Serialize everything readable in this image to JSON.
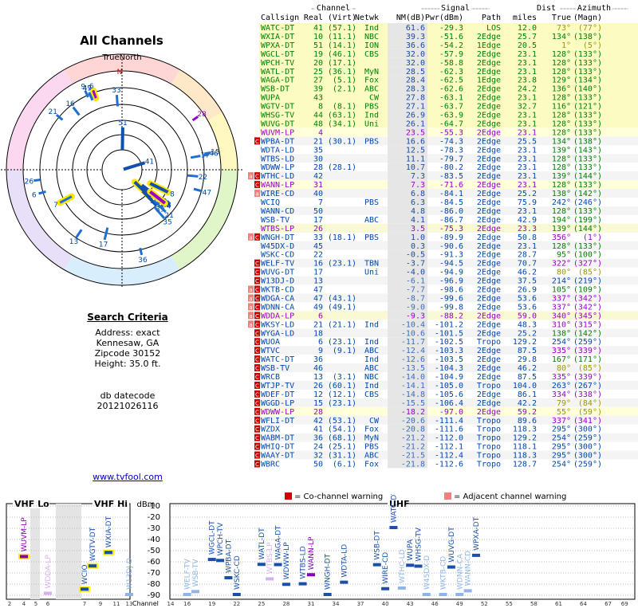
{
  "page": {
    "title": "All Channels",
    "north_label": "TrueNorth",
    "criteria": {
      "heading": "Search Criteria",
      "lines": [
        "Address: exact",
        "Kennesaw, GA",
        "Zipcode 30152",
        "Height: 35.0 ft."
      ],
      "datecode_label": "db datecode",
      "datecode": "20121026116"
    },
    "link": "www.tvfool.com",
    "warnings": {
      "co": "= Co-channel warning",
      "adj": "= Adjacent channel warning"
    }
  },
  "colors": {
    "green": "#008000",
    "blue": "#0047ab",
    "lightblue": "#6a9bd8",
    "violet": "#9900cc",
    "gray": "#808080",
    "olive": "#999900",
    "red": "#cc0000"
  },
  "table": {
    "group_headers": {
      "channel": "Channel",
      "signal": "Signal",
      "dist": "Dist",
      "azimuth": "Azimuth"
    },
    "columns": [
      "Callsign",
      "Real",
      "(Virt)",
      "Netwk",
      "NM(dB)",
      "Pwr(dBm)",
      "Path",
      "miles",
      "True",
      "(Magn)"
    ],
    "rows": [
      [
        "WATC-DT",
        "41",
        "(57.1)",
        "Ind",
        "61.6",
        "-29.3",
        "LOS",
        "12.0",
        "73°",
        "(77°)",
        "",
        "green"
      ],
      [
        "WXIA-DT",
        "10",
        "(11.1)",
        "NBC",
        "39.3",
        "-51.6",
        "2Edge",
        "25.7",
        "134°",
        "(138°)",
        "",
        "green"
      ],
      [
        "WPXA-DT",
        "51",
        "(14.1)",
        "ION",
        "36.6",
        "-54.2",
        "1Edge",
        "20.5",
        "1°",
        "(5°)",
        "",
        "green"
      ],
      [
        "WGCL-DT",
        "19",
        "(46.1)",
        "CBS",
        "32.0",
        "-57.9",
        "2Edge",
        "23.1",
        "128°",
        "(133°)",
        "",
        "green"
      ],
      [
        "WPCH-TV",
        "20",
        "(17.1)",
        "",
        "32.0",
        "-58.8",
        "2Edge",
        "23.1",
        "128°",
        "(133°)",
        "",
        "green"
      ],
      [
        "WATL-DT",
        "25",
        "(36.1)",
        "MyN",
        "28.5",
        "-62.3",
        "2Edge",
        "23.1",
        "128°",
        "(133°)",
        "",
        "green"
      ],
      [
        "WAGA-DT",
        "27",
        "(5.1)",
        "Fox",
        "28.4",
        "-62.5",
        "1Edge",
        "23.8",
        "129°",
        "(134°)",
        "",
        "green"
      ],
      [
        "WSB-DT",
        "39",
        "(2.1)",
        "ABC",
        "28.3",
        "-62.6",
        "2Edge",
        "24.2",
        "136°",
        "(140°)",
        "",
        "green"
      ],
      [
        "WUPA",
        "43",
        "",
        "CW",
        "27.8",
        "-63.1",
        "2Edge",
        "23.1",
        "128°",
        "(133°)",
        "",
        "green"
      ],
      [
        "WGTV-DT",
        "8",
        "(8.1)",
        "PBS",
        "27.1",
        "-63.7",
        "2Edge",
        "32.7",
        "116°",
        "(121°)",
        "",
        "green"
      ],
      [
        "WHSG-TV",
        "44",
        "(63.1)",
        "Ind",
        "26.9",
        "-63.9",
        "2Edge",
        "23.1",
        "128°",
        "(133°)",
        "",
        "green"
      ],
      [
        "WUVG-DT",
        "48",
        "(34.1)",
        "Uni",
        "26.1",
        "-64.7",
        "2Edge",
        "23.1",
        "128°",
        "(133°)",
        "",
        "green"
      ],
      [
        "WUVM-LP",
        "4",
        "",
        "",
        "23.5",
        "-55.3",
        "2Edge",
        "23.1",
        "128°",
        "(133°)",
        "",
        "violet"
      ],
      [
        "WPBA-DT",
        "21",
        "(30.1)",
        "PBS",
        "16.6",
        "-74.3",
        "2Edge",
        "25.5",
        "134°",
        "(138°)",
        "C",
        "blue"
      ],
      [
        "WDTA-LD",
        "35",
        "",
        "",
        "12.5",
        "-78.3",
        "2Edge",
        "23.1",
        "139°",
        "(143°)",
        "",
        "blue"
      ],
      [
        "WTBS-LD",
        "30",
        "",
        "",
        "11.1",
        "-79.7",
        "2Edge",
        "23.1",
        "128°",
        "(133°)",
        "",
        "blue"
      ],
      [
        "WDWW-LP",
        "28",
        "(28.1)",
        "",
        "10.7",
        "-80.2",
        "2Edge",
        "23.1",
        "128°",
        "(133°)",
        "",
        "blue"
      ],
      [
        "WTHC-LD",
        "42",
        "",
        "",
        "7.3",
        "-83.5",
        "2Edge",
        "23.1",
        "139°",
        "(144°)",
        "aC",
        "blue"
      ],
      [
        "WANN-LP",
        "31",
        "",
        "",
        "7.3",
        "-71.6",
        "2Edge",
        "23.1",
        "128°",
        "(133°)",
        "C",
        "violet"
      ],
      [
        "WIRE-CD",
        "40",
        "",
        "",
        "6.8",
        "-84.1",
        "2Edge",
        "25.2",
        "138°",
        "(142°)",
        "a",
        "blue"
      ],
      [
        "WCIQ",
        "7",
        "",
        "PBS",
        "6.3",
        "-84.5",
        "2Edge",
        "75.9",
        "242°",
        "(246°)",
        "",
        "blue"
      ],
      [
        "WANN-CD",
        "50",
        "",
        "",
        "4.8",
        "-86.0",
        "2Edge",
        "23.1",
        "128°",
        "(133°)",
        "",
        "blue"
      ],
      [
        "WSB-TV",
        "17",
        "",
        "ABC",
        "4.1",
        "-86.7",
        "2Edge",
        "42.9",
        "194°",
        "(199°)",
        "",
        "blue"
      ],
      [
        "WTBS-LP",
        "26",
        "",
        "",
        "3.5",
        "-75.3",
        "2Edge",
        "23.3",
        "139°",
        "(144°)",
        "",
        "violet"
      ],
      [
        "WNGH-DT",
        "33",
        "(18.1)",
        "PBS",
        "1.0",
        "-89.9",
        "2Edge",
        "50.8",
        "356°",
        "(1°)",
        "aC",
        "blue"
      ],
      [
        "W45DX-D",
        "45",
        "",
        "",
        "0.3",
        "-90.6",
        "2Edge",
        "23.1",
        "128°",
        "(133°)",
        "",
        "blue"
      ],
      [
        "WSKC-CD",
        "22",
        "",
        "",
        "-0.5",
        "-91.3",
        "2Edge",
        "28.7",
        "95°",
        "(100°)",
        "",
        "blue"
      ],
      [
        "WELF-TV",
        "16",
        "(23.1)",
        "TBN",
        "-3.7",
        "-94.5",
        "2Edge",
        "70.7",
        "322°",
        "(327°)",
        "C",
        "blue"
      ],
      [
        "WUVG-DT",
        "17",
        "",
        "Uni",
        "-4.0",
        "-94.9",
        "2Edge",
        "46.2",
        "80°",
        "(85°)",
        "C",
        "blue"
      ],
      [
        "W13DJ-D",
        "13",
        "",
        "",
        "-6.1",
        "-96.9",
        "2Edge",
        "37.5",
        "214°",
        "(219°)",
        "C",
        "blue"
      ],
      [
        "WKTB-CD",
        "47",
        "",
        "",
        "-7.7",
        "-98.6",
        "2Edge",
        "26.9",
        "105°",
        "(109°)",
        "aC",
        "blue"
      ],
      [
        "WDGA-CA",
        "47",
        "(43.1)",
        "",
        "-8.7",
        "-99.6",
        "2Edge",
        "53.6",
        "337°",
        "(342°)",
        "aC",
        "blue"
      ],
      [
        "WDNN-CA",
        "49",
        "(49.1)",
        "",
        "-9.0",
        "-99.8",
        "2Edge",
        "53.6",
        "337°",
        "(342°)",
        "aC",
        "blue"
      ],
      [
        "WDDA-LP",
        "6",
        "",
        "",
        "-9.3",
        "-88.2",
        "2Edge",
        "59.0",
        "340°",
        "(345°)",
        "aC",
        "violet"
      ],
      [
        "WKSY-LD",
        "21",
        "(21.1)",
        "Ind",
        "-10.4",
        "-101.2",
        "2Edge",
        "48.3",
        "310°",
        "(315°)",
        "aC",
        "blue"
      ],
      [
        "WYGA-LD",
        "18",
        "",
        "",
        "-10.6",
        "-101.5",
        "2Edge",
        "25.2",
        "138°",
        "(142°)",
        "C",
        "blue"
      ],
      [
        "WUOA",
        "6",
        "(23.1)",
        "Ind",
        "-11.7",
        "-102.5",
        "Tropo",
        "129.2",
        "254°",
        "(259°)",
        "C",
        "blue"
      ],
      [
        "WTVC",
        "9",
        "(9.1)",
        "ABC",
        "-12.4",
        "-103.3",
        "2Edge",
        "87.5",
        "335°",
        "(339°)",
        "C",
        "blue"
      ],
      [
        "WATC-DT",
        "36",
        "",
        "Ind",
        "-12.6",
        "-103.5",
        "2Edge",
        "29.8",
        "167°",
        "(171°)",
        "C",
        "blue"
      ],
      [
        "WSB-TV",
        "46",
        "",
        "ABC",
        "-13.5",
        "-104.3",
        "2Edge",
        "46.2",
        "80°",
        "(85°)",
        "C",
        "blue"
      ],
      [
        "WRCB",
        "13",
        "(3.1)",
        "NBC",
        "-14.0",
        "-104.9",
        "2Edge",
        "87.5",
        "335°",
        "(339°)",
        "C",
        "blue"
      ],
      [
        "WTJP-TV",
        "26",
        "(60.1)",
        "Ind",
        "-14.1",
        "-105.0",
        "Tropo",
        "104.0",
        "263°",
        "(267°)",
        "C",
        "blue"
      ],
      [
        "WDEF-DT",
        "12",
        "(12.1)",
        "CBS",
        "-14.8",
        "-105.6",
        "2Edge",
        "86.1",
        "334°",
        "(338°)",
        "C",
        "blue"
      ],
      [
        "WGGD-LP",
        "15",
        "(23.1)",
        "",
        "-15.5",
        "-106.4",
        "2Edge",
        "42.2",
        "79°",
        "(84°)",
        "C",
        "blue"
      ],
      [
        "WDWW-LP",
        "28",
        "",
        "",
        "-18.2",
        "-97.0",
        "2Edge",
        "59.2",
        "55°",
        "(59°)",
        "C",
        "violet"
      ],
      [
        "WFLI-DT",
        "42",
        "(53.1)",
        "CW",
        "-20.6",
        "-111.4",
        "Tropo",
        "89.6",
        "337°",
        "(341°)",
        "C",
        "blue"
      ],
      [
        "WZDX",
        "41",
        "(54.1)",
        "Fox",
        "-20.8",
        "-111.6",
        "Tropo",
        "118.3",
        "295°",
        "(300°)",
        "C",
        "blue"
      ],
      [
        "WABM-DT",
        "36",
        "(68.1)",
        "MyN",
        "-21.2",
        "-112.0",
        "Tropo",
        "129.2",
        "254°",
        "(259°)",
        "C",
        "blue"
      ],
      [
        "WHIQ-DT",
        "24",
        "(25.1)",
        "PBS",
        "-21.2",
        "-112.1",
        "Tropo",
        "118.1",
        "295°",
        "(300°)",
        "C",
        "blue"
      ],
      [
        "WAAY-DT",
        "32",
        "(31.1)",
        "ABC",
        "-21.5",
        "-112.4",
        "Tropo",
        "118.3",
        "295°",
        "(300°)",
        "C",
        "blue"
      ],
      [
        "WBRC",
        "50",
        "(6.1)",
        "Fox",
        "-21.8",
        "-112.6",
        "Tropo",
        "128.7",
        "254°",
        "(259°)",
        "C",
        "blue"
      ]
    ]
  },
  "chart_data": [
    {
      "type": "scatter",
      "title": "All Channels",
      "subtype": "polar",
      "axis": "azimuth in degrees (true north at top), radius = signal strength",
      "points": [
        {
          "label": "51",
          "azimuth": 1,
          "nm": 36.6
        },
        {
          "label": "41",
          "azimuth": 73,
          "nm": 61.6
        },
        {
          "label": "10",
          "azimuth": 134,
          "nm": 39.3
        },
        {
          "label": "9",
          "azimuth": 335,
          "nm": -12.4
        },
        {
          "label": "6",
          "azimuth": 340,
          "nm": -9.3
        },
        {
          "label": "49",
          "azimuth": 337,
          "nm": -9.0
        },
        {
          "label": "47",
          "azimuth": 337,
          "nm": -8.7
        },
        {
          "label": "33",
          "azimuth": 356,
          "nm": 1.0
        },
        {
          "label": "28",
          "azimuth": 55,
          "nm": -18.2
        },
        {
          "label": "17",
          "azimuth": 80,
          "nm": -4.0
        },
        {
          "label": "46",
          "azimuth": 80,
          "nm": -13.5
        },
        {
          "label": "15",
          "azimuth": 79,
          "nm": -15.5
        },
        {
          "label": "22",
          "azimuth": 95,
          "nm": -0.5
        },
        {
          "label": "47",
          "azimuth": 105,
          "nm": -7.7
        },
        {
          "label": "8",
          "azimuth": 116,
          "nm": 27.1
        },
        {
          "label": "19",
          "azimuth": 128,
          "nm": 32.0
        },
        {
          "label": "20",
          "azimuth": 128,
          "nm": 32.0
        },
        {
          "label": "25",
          "azimuth": 128,
          "nm": 28.5
        },
        {
          "label": "27",
          "azimuth": 129,
          "nm": 28.4
        },
        {
          "label": "39",
          "azimuth": 136,
          "nm": 28.3
        },
        {
          "label": "43",
          "azimuth": 128,
          "nm": 27.8
        },
        {
          "label": "44",
          "azimuth": 128,
          "nm": 26.9
        },
        {
          "label": "48",
          "azimuth": 128,
          "nm": 26.1
        },
        {
          "label": "4",
          "azimuth": 128,
          "nm": 23.5
        },
        {
          "label": "21",
          "azimuth": 134,
          "nm": 16.6
        },
        {
          "label": "35",
          "azimuth": 139,
          "nm": 12.5
        },
        {
          "label": "36",
          "azimuth": 167,
          "nm": -12.6
        },
        {
          "label": "17",
          "azimuth": 194,
          "nm": 4.1
        },
        {
          "label": "13",
          "azimuth": 214,
          "nm": -6.1
        },
        {
          "label": "7",
          "azimuth": 242,
          "nm": 6.3
        },
        {
          "label": "6",
          "azimuth": 254,
          "nm": -11.7
        },
        {
          "label": "26",
          "azimuth": 263,
          "nm": -14.1
        },
        {
          "label": "21",
          "azimuth": 310,
          "nm": -10.4
        },
        {
          "label": "16",
          "azimuth": 322,
          "nm": -3.7
        }
      ]
    },
    {
      "type": "bar",
      "title": "",
      "ylabel": "dBm",
      "xlabel": "Channel",
      "ylim": [
        -90,
        -10
      ],
      "yticks": [
        -10,
        -20,
        -30,
        -40,
        -50,
        -60,
        -70,
        -80,
        -90
      ],
      "sections": [
        "VHF Lo",
        "VHF Hi",
        "UHF"
      ],
      "xticks": [
        2,
        4,
        5,
        6,
        7,
        9,
        11,
        13,
        14,
        16,
        19,
        22,
        25,
        28,
        31,
        34,
        37,
        40,
        43,
        46,
        49,
        52,
        55,
        58,
        61,
        64,
        67,
        69
      ],
      "points": [
        {
          "ch": 4,
          "dbm": -55.3,
          "label": "WUVM-LP",
          "c": "violet",
          "hl": true
        },
        {
          "ch": 6,
          "dbm": -88.2,
          "label": "WDDA-LP",
          "c": "violetlight"
        },
        {
          "ch": 7,
          "dbm": -84.5,
          "label": "WCIQ",
          "c": "blue",
          "hl": true
        },
        {
          "ch": 8,
          "dbm": -63.7,
          "label": "WGTV-DT",
          "c": "blue",
          "hl": true
        },
        {
          "ch": 10,
          "dbm": -51.6,
          "label": "WXIA-DT",
          "c": "blue",
          "hl": true
        },
        {
          "ch": 13,
          "dbm": -96.9,
          "label": "W13DJ-D",
          "c": "lightblue"
        },
        {
          "ch": 16,
          "dbm": -94.5,
          "label": "WELF-TV",
          "c": "lightblue"
        },
        {
          "ch": 17,
          "dbm": -86.7,
          "label": "WSB-TV",
          "c": "lightblue"
        },
        {
          "ch": 19,
          "dbm": -57.9,
          "label": "WGCL-DT",
          "c": "blue"
        },
        {
          "ch": 20,
          "dbm": -58.8,
          "label": "WPCH-TV",
          "c": "blue"
        },
        {
          "ch": 21,
          "dbm": -74.3,
          "label": "WPBA-DT",
          "c": "blue"
        },
        {
          "ch": 22,
          "dbm": -91.3,
          "label": "WSKC-CD",
          "c": "blue"
        },
        {
          "ch": 25,
          "dbm": -62.3,
          "label": "WATL-DT",
          "c": "blue"
        },
        {
          "ch": 26,
          "dbm": -75.3,
          "label": "WTBS-LP",
          "c": "violetlight"
        },
        {
          "ch": 27,
          "dbm": -62.5,
          "label": "WAGA-DT",
          "c": "blue"
        },
        {
          "ch": 28,
          "dbm": -80.2,
          "label": "WDWW-LP",
          "c": "blue"
        },
        {
          "ch": 30,
          "dbm": -79.7,
          "label": "WTBS-LD",
          "c": "blue"
        },
        {
          "ch": 31,
          "dbm": -71.6,
          "label": "WANN-LP",
          "c": "violet"
        },
        {
          "ch": 33,
          "dbm": -89.9,
          "label": "WNGH-DT",
          "c": "blue"
        },
        {
          "ch": 35,
          "dbm": -78.3,
          "label": "WDTA-LD",
          "c": "blue"
        },
        {
          "ch": 39,
          "dbm": -62.6,
          "label": "WSB-DT",
          "c": "blue"
        },
        {
          "ch": 40,
          "dbm": -84.1,
          "label": "WIRE-CD",
          "c": "blue"
        },
        {
          "ch": 41,
          "dbm": -29.3,
          "label": "WATC-DT",
          "c": "blue"
        },
        {
          "ch": 42,
          "dbm": -83.5,
          "label": "WTHC-LD",
          "c": "lightblue"
        },
        {
          "ch": 43,
          "dbm": -63.1,
          "label": "WUPA",
          "c": "blue"
        },
        {
          "ch": 44,
          "dbm": -63.9,
          "label": "WHSG-TV",
          "c": "blue"
        },
        {
          "ch": 45,
          "dbm": -90.6,
          "label": "W45DX-D",
          "c": "lightblue"
        },
        {
          "ch": 47,
          "dbm": -98.6,
          "label": "WKTB-CD",
          "c": "lightblue"
        },
        {
          "ch": 48,
          "dbm": -64.7,
          "label": "WUVG-DT",
          "c": "blue"
        },
        {
          "ch": 49,
          "dbm": -99.8,
          "label": "WDNN-CA",
          "c": "lightblue"
        },
        {
          "ch": 50,
          "dbm": -86.0,
          "label": "WANN-CD",
          "c": "lightblue"
        },
        {
          "ch": 51,
          "dbm": -54.2,
          "label": "WPXA-DT",
          "c": "blue"
        }
      ]
    }
  ]
}
